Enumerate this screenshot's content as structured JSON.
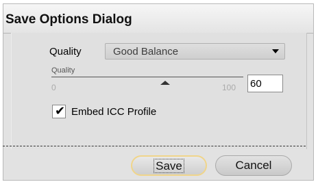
{
  "dialog": {
    "title": "Save Options Dialog"
  },
  "quality": {
    "label": "Quality",
    "selected": "Good Balance"
  },
  "slider": {
    "label": "Quality",
    "min_label": "0",
    "max_label": "100",
    "value": 60,
    "value_text": "60"
  },
  "embed_icc": {
    "label": "Embed ICC Profile",
    "checked": true,
    "check_glyph": "✔"
  },
  "buttons": {
    "save": "Save",
    "cancel": "Cancel"
  },
  "colors": {
    "save_focus_border": "#f0d58a",
    "dialog_bg": "#e2e2e2"
  }
}
